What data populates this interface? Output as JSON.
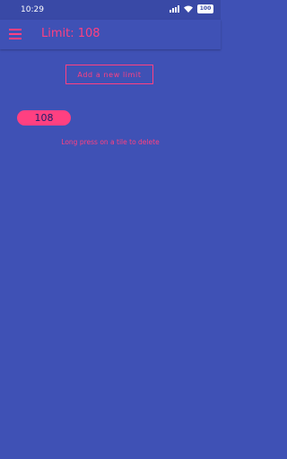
{
  "status_bar": {
    "time": "10:29",
    "battery": "100",
    "icons": [
      "signal-icon",
      "wifi-icon",
      "battery-icon"
    ]
  },
  "app_bar": {
    "menu_icon": "hamburger-menu-icon",
    "title": "Limit: 108"
  },
  "actions": {
    "add_limit_label": "Add a new limit"
  },
  "limits": [
    {
      "value": "108"
    }
  ],
  "hint": "Long press on a tile to delete",
  "colors": {
    "background": "#3f51b5",
    "status_bar": "#3949a6",
    "accent": "#ff4081"
  }
}
